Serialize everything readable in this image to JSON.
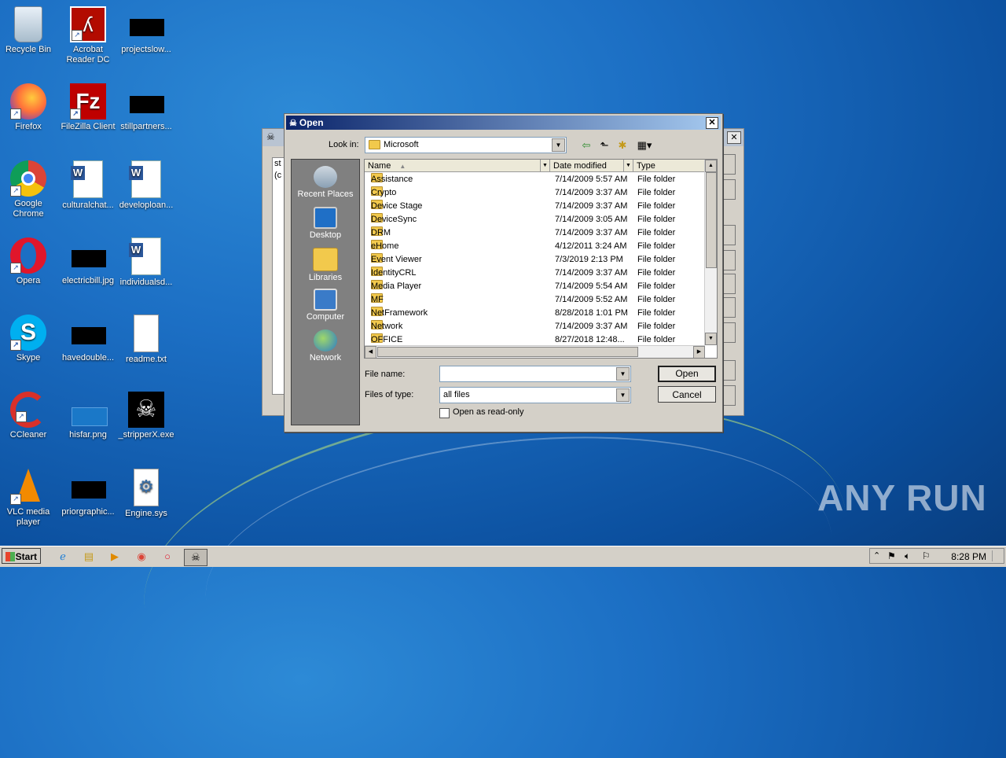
{
  "desktop": {
    "icons": [
      {
        "label": "Recycle Bin"
      },
      {
        "label": "Acrobat Reader DC"
      },
      {
        "label": "projectslow..."
      },
      {
        "label": "Firefox"
      },
      {
        "label": "FileZilla Client"
      },
      {
        "label": "stillpartners..."
      },
      {
        "label": "Google Chrome"
      },
      {
        "label": "culturalchat..."
      },
      {
        "label": "developloan..."
      },
      {
        "label": "Opera"
      },
      {
        "label": "electricbill.jpg"
      },
      {
        "label": "individualsd..."
      },
      {
        "label": "Skype"
      },
      {
        "label": "havedouble..."
      },
      {
        "label": "readme.txt"
      },
      {
        "label": "CCleaner"
      },
      {
        "label": "hisfar.png"
      },
      {
        "label": "_stripperX.exe"
      },
      {
        "label": "VLC media player"
      },
      {
        "label": "priorgraphic..."
      },
      {
        "label": "Engine.sys"
      }
    ],
    "watermark": "ANY RUN"
  },
  "background_window": {
    "text_lines": [
      "st",
      "(c"
    ]
  },
  "dialog": {
    "title": "Open",
    "close_glyph": "✕",
    "look_in_label": "Look in:",
    "look_in_value": "Microsoft",
    "places": [
      "Recent Places",
      "Desktop",
      "Libraries",
      "Computer",
      "Network"
    ],
    "columns": {
      "name": "Name",
      "date": "Date modified",
      "type": "Type"
    },
    "files": [
      {
        "name": "Assistance",
        "date": "7/14/2009 5:57 AM",
        "type": "File folder"
      },
      {
        "name": "Crypto",
        "date": "7/14/2009 3:37 AM",
        "type": "File folder"
      },
      {
        "name": "Device Stage",
        "date": "7/14/2009 3:37 AM",
        "type": "File folder"
      },
      {
        "name": "DeviceSync",
        "date": "7/14/2009 3:05 AM",
        "type": "File folder"
      },
      {
        "name": "DRM",
        "date": "7/14/2009 3:37 AM",
        "type": "File folder"
      },
      {
        "name": "eHome",
        "date": "4/12/2011 3:24 AM",
        "type": "File folder"
      },
      {
        "name": "Event Viewer",
        "date": "7/3/2019 2:13 PM",
        "type": "File folder"
      },
      {
        "name": "IdentityCRL",
        "date": "7/14/2009 3:37 AM",
        "type": "File folder"
      },
      {
        "name": "Media Player",
        "date": "7/14/2009 5:54 AM",
        "type": "File folder"
      },
      {
        "name": "MF",
        "date": "7/14/2009 5:52 AM",
        "type": "File folder"
      },
      {
        "name": "NetFramework",
        "date": "8/28/2018 1:01 PM",
        "type": "File folder"
      },
      {
        "name": "Network",
        "date": "7/14/2009 3:37 AM",
        "type": "File folder"
      },
      {
        "name": "OFFICE",
        "date": "8/27/2018 12:48...",
        "type": "File folder"
      }
    ],
    "file_name_label": "File name:",
    "file_name_value": "",
    "files_of_type_label": "Files of type:",
    "files_of_type_value": "all files",
    "read_only_label": "Open as read-only",
    "open_button": "Open",
    "cancel_button": "Cancel"
  },
  "taskbar": {
    "start_label": "Start",
    "clock": "8:28 PM"
  }
}
